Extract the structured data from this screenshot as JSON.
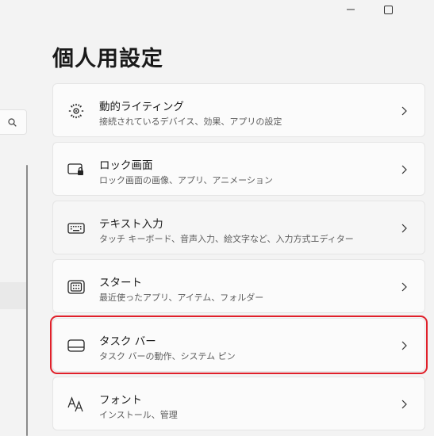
{
  "window": {
    "minimize_icon": "minimize-icon",
    "maximize_icon": "maximize-icon"
  },
  "sidebar": {
    "search_icon": "search-icon"
  },
  "page": {
    "title": "個人用設定"
  },
  "items": [
    {
      "title": "動的ライティング",
      "subtitle": "接続されているデバイス、効果、アプリの設定",
      "icon": "dynamic-lighting-icon"
    },
    {
      "title": "ロック画面",
      "subtitle": "ロック画面の画像、アプリ、アニメーション",
      "icon": "lock-screen-icon"
    },
    {
      "title": "テキスト入力",
      "subtitle": "タッチ キーボード、音声入力、絵文字など、入力方式エディター",
      "icon": "keyboard-icon"
    },
    {
      "title": "スタート",
      "subtitle": "最近使ったアプリ、アイテム、フォルダー",
      "icon": "start-icon"
    },
    {
      "title": "タスク バー",
      "subtitle": "タスク バーの動作、システム ピン",
      "icon": "taskbar-icon",
      "highlighted": true
    },
    {
      "title": "フォント",
      "subtitle": "インストール、管理",
      "icon": "fonts-icon"
    }
  ],
  "colors": {
    "background": "#f3f3f3",
    "card": "#fbfbfb",
    "highlight_border": "#e0202a"
  }
}
